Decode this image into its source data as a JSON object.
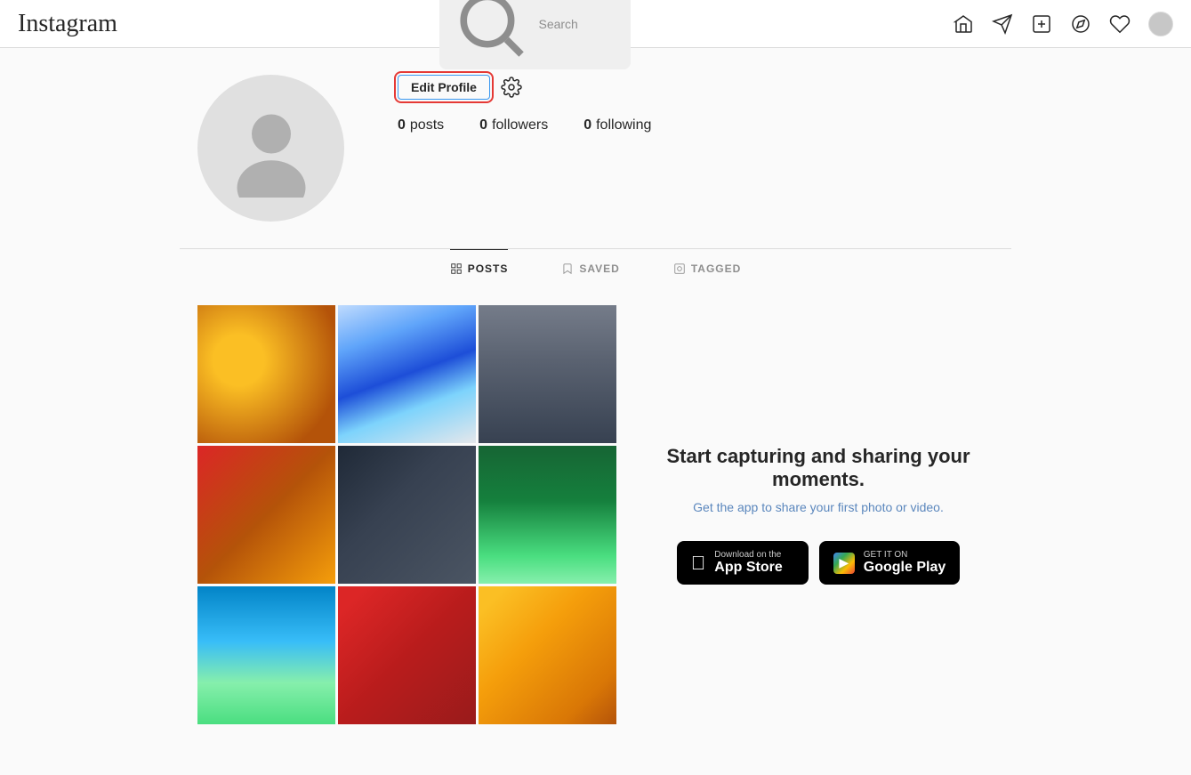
{
  "header": {
    "logo": "Instagram",
    "search_placeholder": "Search",
    "nav_icons": [
      "home",
      "send",
      "add",
      "explore",
      "heart",
      "profile"
    ]
  },
  "profile": {
    "edit_button_label": "Edit Profile",
    "stats": {
      "posts": {
        "count": "0",
        "label": "posts"
      },
      "followers": {
        "count": "0",
        "label": "followers"
      },
      "following": {
        "count": "0",
        "label": "following"
      }
    }
  },
  "tabs": [
    {
      "label": "POSTS",
      "active": true
    },
    {
      "label": "SAVED",
      "active": false
    },
    {
      "label": "TAGGED",
      "active": false
    }
  ],
  "promo": {
    "heading": "Start capturing and sharing your moments.",
    "subtext": "Get the app to share your first photo or video.",
    "appstore_sub": "Download on the",
    "appstore_main": "App Store",
    "googleplay_sub": "GET IT ON",
    "googleplay_main": "Google Play"
  }
}
